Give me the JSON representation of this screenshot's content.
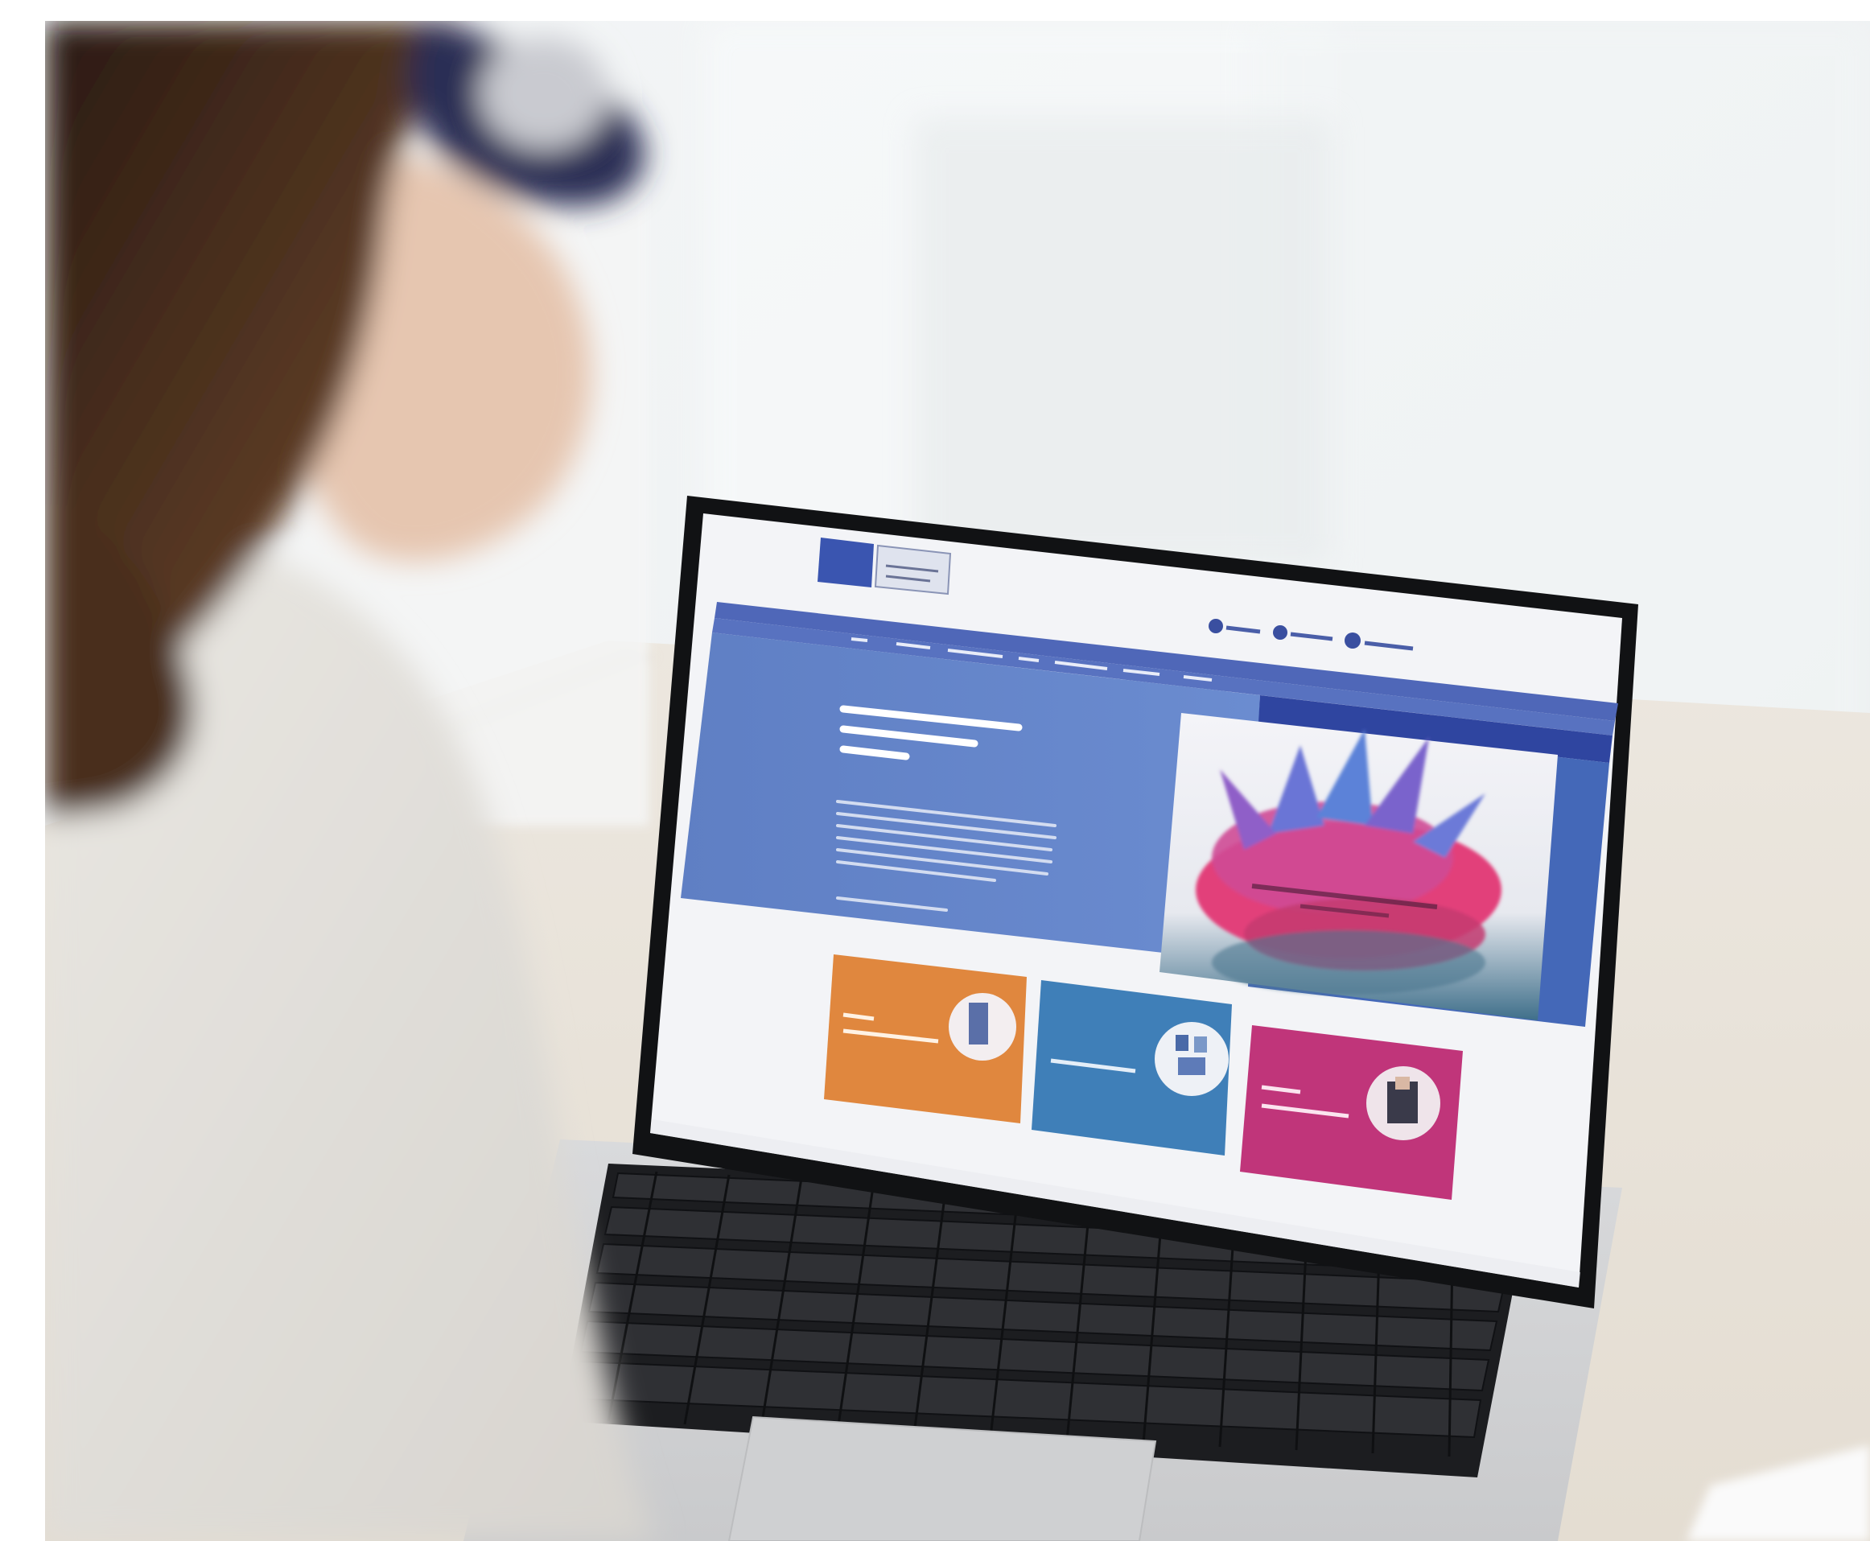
{
  "scene": {
    "description_icons": [
      "person-with-headphones",
      "laptop-icon",
      "plant-icon"
    ],
    "colors": {
      "site_blue": "#4f67b8",
      "site_dark_blue": "#2c3f98",
      "card_orange": "#e0873e",
      "card_blue": "#3f7fb8",
      "card_magenta": "#c0357a",
      "splash_pink": "#e0437a",
      "splash_blue": "#5a79d4"
    }
  },
  "laptop_screen": {
    "nav_items": [
      "",
      "",
      "",
      "",
      "",
      "",
      "",
      ""
    ],
    "hero_title": "",
    "hero_text": "",
    "cards": [
      {
        "color": "#e0873e",
        "label": ""
      },
      {
        "color": "#3f7fb8",
        "label": ""
      },
      {
        "color": "#c0357a",
        "label": ""
      }
    ]
  }
}
